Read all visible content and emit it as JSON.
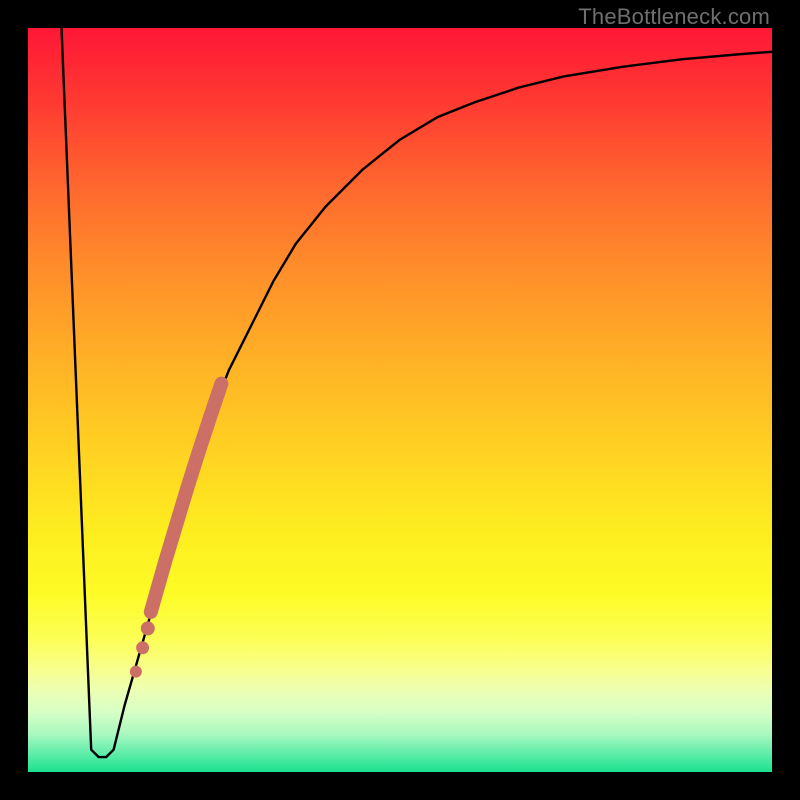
{
  "watermark": "TheBottleneck.com",
  "chart_data": {
    "type": "line",
    "title": "",
    "xlabel": "",
    "ylabel": "",
    "xlim": [
      0,
      100
    ],
    "ylim": [
      0,
      1
    ],
    "curve": {
      "x": [
        4.5,
        8.5,
        9.5,
        10.5,
        11.5,
        13,
        15,
        17,
        19,
        21,
        23,
        25,
        27,
        30,
        33,
        36,
        40,
        45,
        50,
        55,
        60,
        66,
        72,
        80,
        88,
        96,
        100
      ],
      "y": [
        1.0,
        0.03,
        0.02,
        0.02,
        0.03,
        0.09,
        0.16,
        0.23,
        0.3,
        0.37,
        0.43,
        0.49,
        0.54,
        0.6,
        0.66,
        0.71,
        0.76,
        0.81,
        0.85,
        0.88,
        0.9,
        0.92,
        0.935,
        0.948,
        0.958,
        0.965,
        0.968
      ]
    },
    "highlight_segment": {
      "x": [
        16.5,
        17.5,
        18.5,
        20.0,
        21.5,
        23.0,
        24.5,
        26.0
      ],
      "y": [
        0.215,
        0.25,
        0.285,
        0.335,
        0.385,
        0.432,
        0.478,
        0.522
      ]
    },
    "highlight_dots": {
      "x": [
        14.5,
        15.4,
        16.1
      ],
      "y": [
        0.135,
        0.167,
        0.193
      ]
    },
    "highlight_color": "#cc6f66"
  }
}
